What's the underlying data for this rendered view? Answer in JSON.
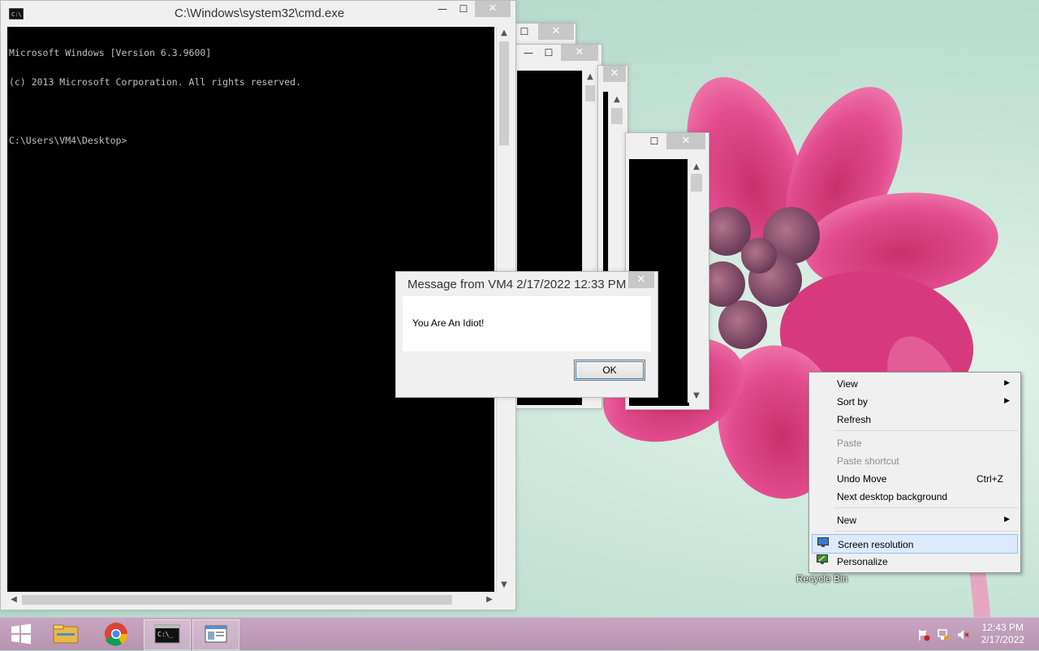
{
  "cmd_main": {
    "title": "C:\\Windows\\system32\\cmd.exe",
    "lines": [
      "Microsoft Windows [Version 6.3.9600]",
      "(c) 2013 Microsoft Corporation. All rights reserved.",
      "",
      "C:\\Users\\VM4\\Desktop>"
    ]
  },
  "dialog": {
    "title": "Message from VM4 2/17/2022 12:33 PM",
    "message": "You Are An Idiot!",
    "ok_label": "OK"
  },
  "context_menu": {
    "view": "View",
    "sort_by": "Sort by",
    "refresh": "Refresh",
    "paste": "Paste",
    "paste_shortcut": "Paste shortcut",
    "undo_move": "Undo Move",
    "undo_shortcut": "Ctrl+Z",
    "next_bg": "Next desktop background",
    "new": "New",
    "screen_resolution": "Screen resolution",
    "personalize": "Personalize"
  },
  "desktop": {
    "recycle_bin": "Recycle Bin"
  },
  "taskbar": {
    "time": "12:43 PM",
    "date": "2/17/2022"
  },
  "glyphs": {
    "minimize": "—",
    "maximize": "☐",
    "close": "✕",
    "up": "▲",
    "down": "▼",
    "left": "◀",
    "right": "▶",
    "submenu": "▶"
  },
  "icons": [
    "windows-logo-icon",
    "file-explorer-icon",
    "chrome-icon",
    "cmd-icon",
    "window-app-icon",
    "action-center-flag-icon",
    "network-icon",
    "volume-muted-icon"
  ]
}
